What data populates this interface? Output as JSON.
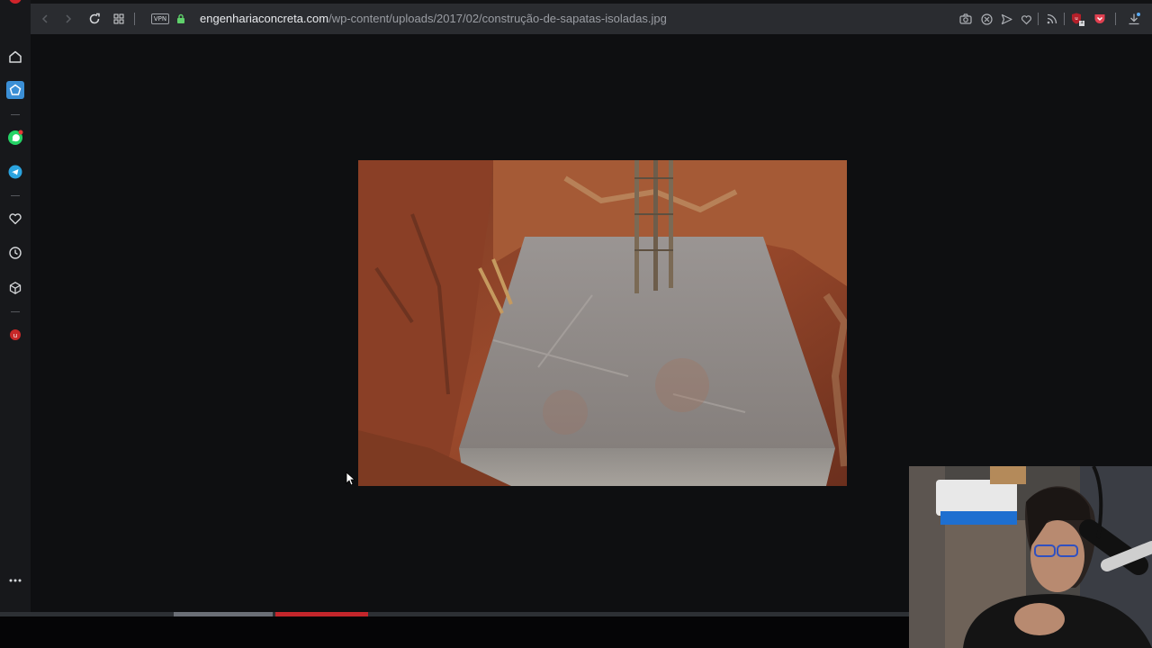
{
  "browser": {
    "url_host": "engenhariaconcreta.com",
    "url_path": "/wp-content/uploads/2017/02/construção-de-sapatas-isoladas.jpg",
    "vpn_label": "VPN",
    "ext_badge_count": "1"
  },
  "sidebar": {
    "items": [
      "home-icon",
      "bookmarks-icon",
      "whatsapp-icon",
      "telegram-icon",
      "heart-icon",
      "history-icon",
      "cube-icon",
      "extension-icon",
      "more-icon"
    ]
  },
  "video": {
    "played_fraction": 0.404,
    "buffered_fraction": 0.3
  },
  "colors": {
    "accent_red": "#c4262b",
    "whatsapp_green": "#25d366",
    "telegram_blue": "#2aa3df",
    "vpn_green": "#5fd16b"
  }
}
